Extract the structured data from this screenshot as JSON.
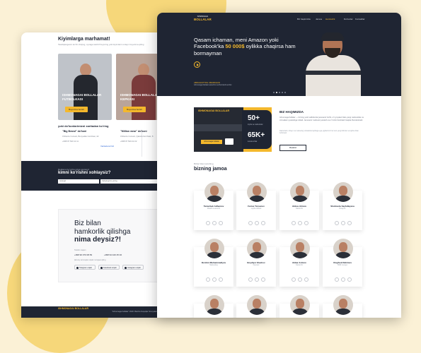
{
  "colors": {
    "accent": "#F4B82C",
    "dark": "#1F2533",
    "background": "#FBF1D6"
  },
  "back_page": {
    "title": "Kiyimlarga marhamat!",
    "subtitle": "Tasdiqlanganni ko'rib chiqing, oynaga tashrif buyuring yoki kiyimlarni onlayn buyurtma qiling",
    "cards": [
      {
        "label": "Ishmonagai bollalar futbolkasi",
        "button": "Buyurtma berish"
      },
      {
        "label": "Ishmonagai bollalar kepkasi",
        "button": "Buyurtma berish"
      }
    ],
    "address_title": "yoki do'konlarimizni xaritadan ko'ring",
    "addresses": [
      {
        "name": "\"Big Brand\" do'koni",
        "street": "Chilonzor tumani, Bunyodkor ko'chasi, 42",
        "phone": "+998 97 520 11 11",
        "link": "Xaritada ko'rish"
      },
      {
        "name": "\"Million wear\" do'koni",
        "street": "Chilonzor tumani, Qatortol ko'chasi, 8",
        "phone": "+998 97 520 22 22",
        "link": "Xaritada ko'rish"
      }
    ],
    "question_small": "Reklama bo'yicha sizga qaytamiz",
    "question_big": "kimni ko'rishni xohlaysiz?",
    "input_name_placeholder": "Ismingiz",
    "input_msg_placeholder": "Xabaringizni yozing",
    "partner_line1": "Biz bilan",
    "partner_line2": "hamkorlik qilishga",
    "partner_line3": "nima deysiz?!",
    "tel_label": "Telefon raqam",
    "phone1": "+998 90 070 08 83",
    "phone2": "+998 94 440 25 40",
    "social_label": "Ijtimoiy tarmoqlar orqali murojaat qiling",
    "social_buttons": [
      "Telegram orqali",
      "Facebook orqali",
      "Instagram orqali"
    ],
    "footer_logo": "ISHMONAGAI BOLLALAR",
    "footer_copy": "\"Ishmonagai bollalar\" 2020. Barcha huquqlar himoyalangan",
    "store1": "App Store",
    "store2": "Google Play"
  },
  "front_page": {
    "logo_small": "ISHMONAGAI",
    "logo_big": "BOLLALAR",
    "nav": [
      "Biz haqimizda",
      "Jamoa",
      "Hamkorlik",
      "Do'konlar",
      "Kontaktlar"
    ],
    "nav_active_index": 2,
    "hero_title_part1": "Qasam ichaman, meni Amazon yoki Facebook'ka ",
    "hero_title_highlight": "50 000$",
    "hero_title_part2": " oylikka chaqirsa ham bormayman",
    "hero_author": "ABDULFATTOH UMARKHAN",
    "hero_role": "Ishmonagai bollalar asoschisi va ilhomlantiruvchisi",
    "about_logo": "ISHMONAGAI BOLLALAR",
    "stat1_value": "50+",
    "stat1_label": "loyiha va mahsulotlar",
    "stat2_value": "65K+",
    "stat2_label": "kuzatuvchilar",
    "chip": "Ishmonagai bollalar",
    "about_title": "BIZ HAQIMIZDA",
    "about_text": "Ishmonagai bollalar — bizning yosh tadbirkorlar jamoamiz bo'lib, o'z g'oyalari bilan yangi mahsulotlar va xizmatlarni yaratishga intiladi. Jamoamiz mahsulot yaratish va o'z ishini boshlash haqida ilhomlantiradi.",
    "about_text2": "Dasturlash, dizayn va marketing sohalarida tajribaga ega yigitlarimiz har kuni yangi bilimlar va tajriba bilan bo'lishadi.",
    "about_button": "Batafsil",
    "team_subtitle": "Bizlar bilan tanishing",
    "team_title": "bizning jamoa",
    "team": [
      {
        "name": "Tamurbek Adhamov",
        "role": "Muallif va asoschi"
      },
      {
        "name": "Farrux Tursunov",
        "role": "Loyiha rahbari"
      },
      {
        "name": "Abbos Ahmov",
        "role": "Dasturchi"
      },
      {
        "name": "Shahnoda Sayfullayeva",
        "role": "Dizayner"
      },
      {
        "name": "Ibrohim Muhammadiyev",
        "role": "Marketolog"
      },
      {
        "name": "Boydiyor Eleehov",
        "role": "Operator"
      },
      {
        "name": "Akbar Azimov",
        "role": "Dasturchi"
      },
      {
        "name": "Ulug'bek Rahimov",
        "role": "SMM menejer"
      }
    ]
  }
}
